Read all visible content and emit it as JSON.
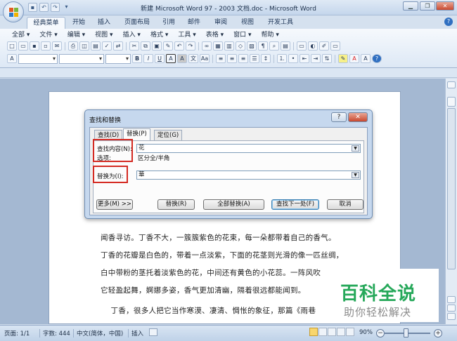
{
  "window": {
    "title": "新建 Microsoft Word 97 - 2003 文档.doc - Microsoft Word"
  },
  "ribbon_tabs": [
    "经典菜单",
    "开始",
    "插入",
    "页面布局",
    "引用",
    "邮件",
    "审阅",
    "视图",
    "开发工具"
  ],
  "classic_menu": [
    "全部 ▾",
    "文件 ▾",
    "编辑 ▾",
    "视图 ▾",
    "插入 ▾",
    "格式 ▾",
    "工具 ▾",
    "表格 ▾",
    "窗口 ▾",
    "帮助 ▾"
  ],
  "format_buttons": {
    "bold": "B",
    "italic": "I",
    "underline": "U",
    "char_border": "A",
    "char_shade": "A"
  },
  "document": {
    "lines": [
      "闻香寻访。丁香不大，一簇簇紫色的花束，每一朵都带着自己的香气。",
      "丁香的花瓣是白色的，带着一点淡紫，下面的花茎则光滑的像一匹丝绸，",
      "白中带粉的茎托着淡紫色的花，中间还有黄色的小花蕊。一阵风吹",
      "它轻盈起舞，婀娜多姿，香气更加清幽，隔着很远都能闻到。",
      "    丁香，很多人把它当作寒漠、凄清、惆怅的象征，那篇《雨巷"
    ]
  },
  "dialog": {
    "title": "查找和替换",
    "help_button": "?",
    "close_button": "✕",
    "tabs": [
      "查找(D)",
      "替换(P)",
      "定位(G)"
    ],
    "find_label": "查找内容(N):",
    "find_value": "花",
    "options_label": "选项:",
    "options_value": "区分全/半角",
    "replace_label": "替换为(I):",
    "replace_value": "華",
    "buttons": {
      "more": "更多(M) >>",
      "replace": "替换(R)",
      "replace_all": "全部替换(A)",
      "find_next": "查找下一处(F)",
      "cancel": "取消"
    }
  },
  "status_bar": {
    "page": "页面: 1/1",
    "words": "字数: 444",
    "language": "中文(简体，中国)",
    "mode": "插入",
    "zoom": "90%"
  },
  "watermark": {
    "title": "百科全说",
    "subtitle": "助你轻松解决"
  },
  "colors": {
    "highlight_box": "#d42a22",
    "watermark_green": "#26a85a"
  }
}
